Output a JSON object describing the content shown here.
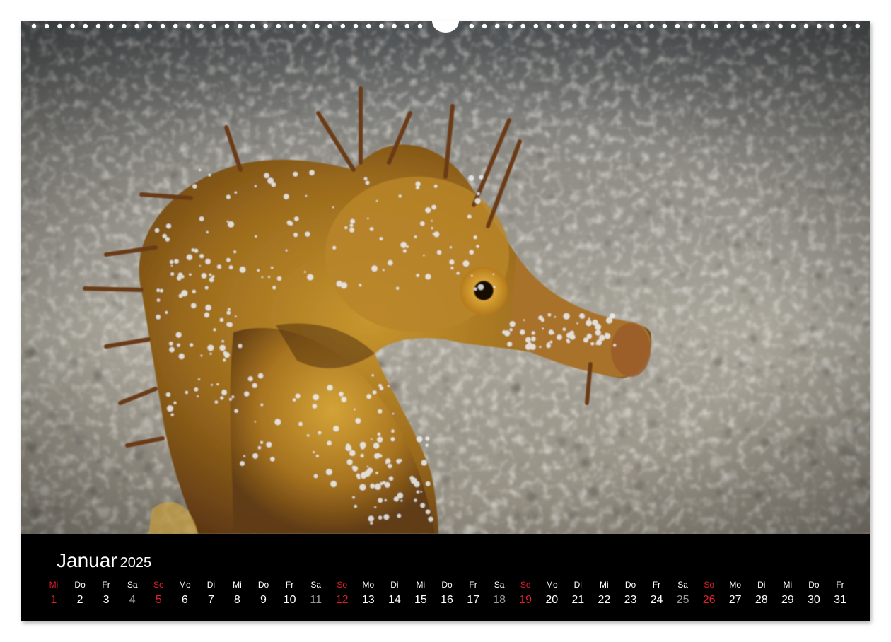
{
  "calendar": {
    "month": "Januar",
    "year": "2025",
    "days": [
      {
        "wd": "Mi",
        "d": "1",
        "type": "sun"
      },
      {
        "wd": "Do",
        "d": "2",
        "type": "normal"
      },
      {
        "wd": "Fr",
        "d": "3",
        "type": "normal"
      },
      {
        "wd": "Sa",
        "d": "4",
        "type": "sat"
      },
      {
        "wd": "So",
        "d": "5",
        "type": "sun"
      },
      {
        "wd": "Mo",
        "d": "6",
        "type": "normal"
      },
      {
        "wd": "Di",
        "d": "7",
        "type": "normal"
      },
      {
        "wd": "Mi",
        "d": "8",
        "type": "normal"
      },
      {
        "wd": "Do",
        "d": "9",
        "type": "normal"
      },
      {
        "wd": "Fr",
        "d": "10",
        "type": "normal"
      },
      {
        "wd": "Sa",
        "d": "11",
        "type": "sat"
      },
      {
        "wd": "So",
        "d": "12",
        "type": "sun"
      },
      {
        "wd": "Mo",
        "d": "13",
        "type": "normal"
      },
      {
        "wd": "Di",
        "d": "14",
        "type": "normal"
      },
      {
        "wd": "Mi",
        "d": "15",
        "type": "normal"
      },
      {
        "wd": "Do",
        "d": "16",
        "type": "normal"
      },
      {
        "wd": "Fr",
        "d": "17",
        "type": "normal"
      },
      {
        "wd": "Sa",
        "d": "18",
        "type": "sat"
      },
      {
        "wd": "So",
        "d": "19",
        "type": "sun"
      },
      {
        "wd": "Mo",
        "d": "20",
        "type": "normal"
      },
      {
        "wd": "Di",
        "d": "21",
        "type": "normal"
      },
      {
        "wd": "Mi",
        "d": "22",
        "type": "normal"
      },
      {
        "wd": "Do",
        "d": "23",
        "type": "normal"
      },
      {
        "wd": "Fr",
        "d": "24",
        "type": "normal"
      },
      {
        "wd": "Sa",
        "d": "25",
        "type": "sat"
      },
      {
        "wd": "So",
        "d": "26",
        "type": "sun"
      },
      {
        "wd": "Mo",
        "d": "27",
        "type": "normal"
      },
      {
        "wd": "Di",
        "d": "28",
        "type": "normal"
      },
      {
        "wd": "Mi",
        "d": "29",
        "type": "normal"
      },
      {
        "wd": "Do",
        "d": "30",
        "type": "normal"
      },
      {
        "wd": "Fr",
        "d": "31",
        "type": "normal"
      }
    ]
  },
  "colors": {
    "sunday": "#e0202a",
    "saturday": "#9a9a9a",
    "band": "#000000"
  },
  "photo": {
    "subject": "seahorse-icon"
  }
}
